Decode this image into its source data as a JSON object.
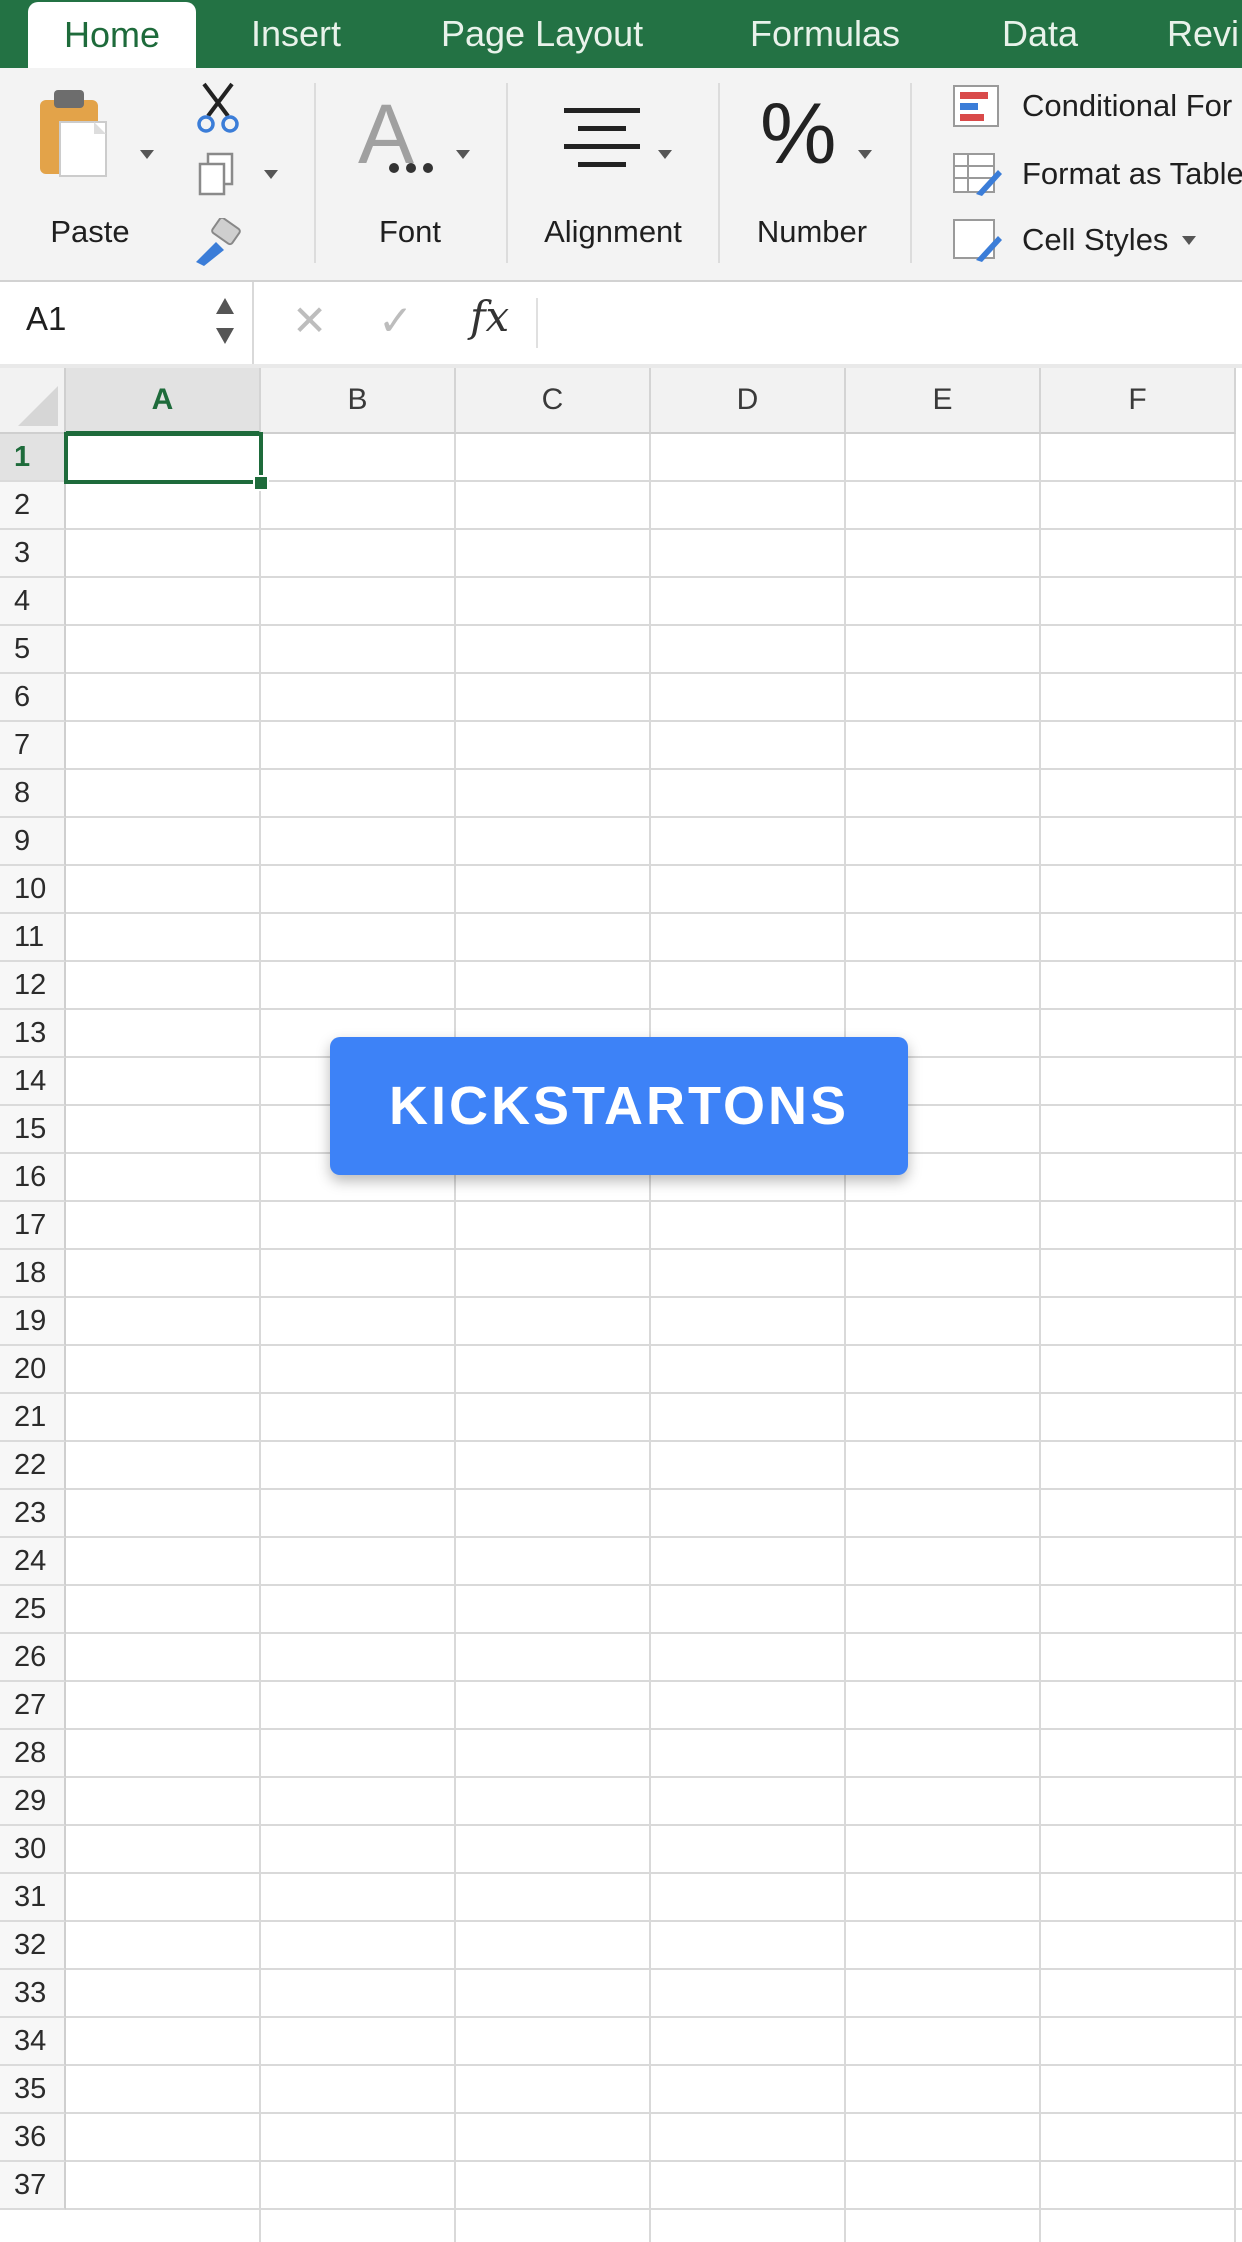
{
  "tabs": [
    {
      "label": "Home",
      "active": true
    },
    {
      "label": "Insert"
    },
    {
      "label": "Page Layout"
    },
    {
      "label": "Formulas"
    },
    {
      "label": "Data"
    },
    {
      "label": "Revi"
    }
  ],
  "ribbon": {
    "paste_label": "Paste",
    "font_label": "Font",
    "alignment_label": "Alignment",
    "number_label": "Number",
    "number_symbol": "%",
    "conditional_formatting_label": "Conditional For",
    "format_as_table_label": "Format as Table",
    "cell_styles_label": "Cell Styles"
  },
  "formula_bar": {
    "name_box": "A1",
    "cancel_symbol": "✕",
    "enter_symbol": "✓",
    "fx_label": "fx",
    "formula_value": ""
  },
  "sheet": {
    "columns": [
      "A",
      "B",
      "C",
      "D",
      "E",
      "F"
    ],
    "rows": [
      "1",
      "2",
      "3",
      "4",
      "5",
      "6",
      "7",
      "8",
      "9",
      "10",
      "11",
      "12",
      "13",
      "14",
      "15",
      "16",
      "17",
      "18",
      "19",
      "20",
      "21",
      "22",
      "23",
      "24",
      "25",
      "26",
      "27",
      "28",
      "29",
      "30",
      "31",
      "32",
      "33",
      "34",
      "35",
      "36",
      "37"
    ],
    "active_cell": "A1",
    "active_column": "A",
    "active_row": "1"
  },
  "overlay": {
    "button_label": "KICKSTARTONS",
    "color": "#3d82f7"
  },
  "colors": {
    "tab_bar": "#237244",
    "accent_green": "#1e6b3b"
  }
}
